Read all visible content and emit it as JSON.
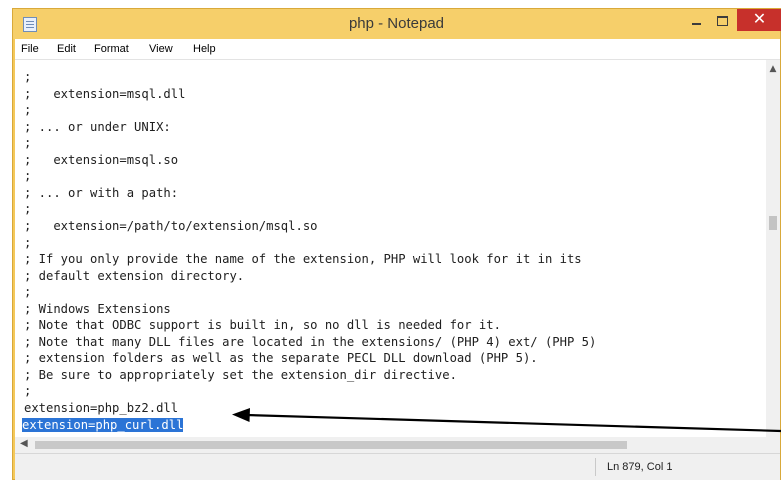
{
  "window": {
    "title": "php - Notepad",
    "controls": {
      "minimize": "",
      "maximize": "",
      "close": "✕"
    }
  },
  "menu": [
    "File",
    "Edit",
    "Format",
    "View",
    "Help"
  ],
  "editor": {
    "lines": [
      ";",
      ";   extension=msql.dll",
      ";",
      "; ... or under UNIX:",
      ";",
      ";   extension=msql.so",
      ";",
      "; ... or with a path:",
      ";",
      ";   extension=/path/to/extension/msql.so",
      ";",
      "; If you only provide the name of the extension, PHP will look for it in its",
      "; default extension directory.",
      ";",
      "; Windows Extensions",
      "; Note that ODBC support is built in, so no dll is needed for it.",
      "; Note that many DLL files are located in the extensions/ (PHP 4) ext/ (PHP 5)",
      "; extension folders as well as the separate PECL DLL download (PHP 5).",
      "; Be sure to appropriately set the extension_dir directive.",
      ";",
      "extension=php_bz2.dll",
      "extension=php_curl.dll"
    ],
    "selected_line": 21
  },
  "status": {
    "position": "Ln 879, Col 1"
  },
  "colors": {
    "titlebar": "#f6cf6a",
    "selection": "#2b74d6",
    "close": "#c7302b",
    "arrow": "#000000"
  },
  "icons": [
    "notepad-icon",
    "minimize-icon",
    "maximize-icon",
    "close-icon",
    "scroll-up-icon",
    "scroll-left-icon",
    "annotation-arrow"
  ]
}
